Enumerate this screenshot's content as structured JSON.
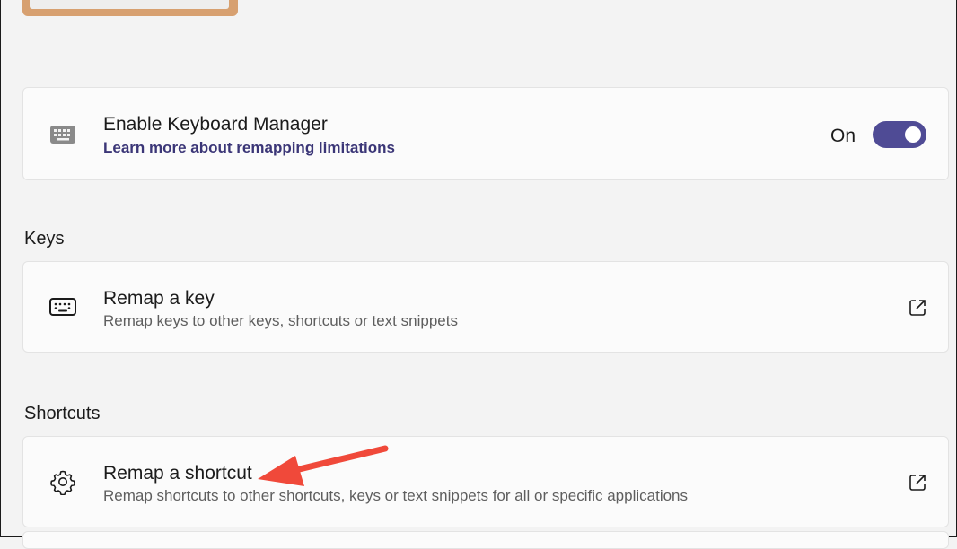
{
  "enable_card": {
    "title": "Enable Keyboard Manager",
    "link": "Learn more about remapping limitations",
    "toggle_state_label": "On",
    "toggle_on": true,
    "icon": "keyboard-icon"
  },
  "sections": [
    {
      "header": "Keys",
      "item": {
        "title": "Remap a key",
        "description": "Remap keys to other keys, shortcuts or text snippets",
        "icon": "keyboard-icon",
        "action_icon": "open-external-icon"
      }
    },
    {
      "header": "Shortcuts",
      "item": {
        "title": "Remap a shortcut",
        "description": "Remap shortcuts to other shortcuts, keys or text snippets for all or specific applications",
        "icon": "gear-icon",
        "action_icon": "open-external-icon"
      }
    }
  ],
  "colors": {
    "accent": "#4f4b95",
    "link": "#3b3677",
    "annotation_arrow": "#f0493a",
    "background": "#f3f3f3",
    "card": "#fbfbfb"
  }
}
